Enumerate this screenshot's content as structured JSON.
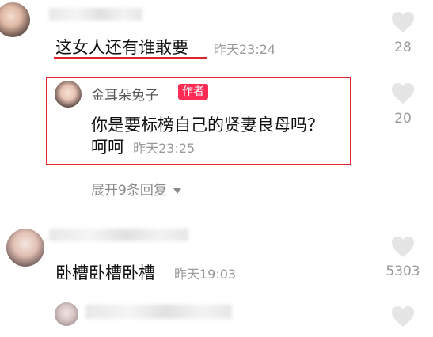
{
  "comments": [
    {
      "text": "这女人还有谁敢要",
      "time": "昨天23:24",
      "likes": "28",
      "reply": {
        "author": "金耳朵兔子",
        "badge": "作者",
        "text_line1": "你是要标榜自己的贤妻良母吗？",
        "text_line2": "呵呵",
        "time": "昨天23:25",
        "likes": "20"
      },
      "expand_label": "展开9条回复"
    },
    {
      "text": "卧槽卧槽卧槽",
      "time": "昨天19:03",
      "likes": "5303"
    }
  ],
  "colors": {
    "highlight_box": "#e0242e",
    "underline": "#e0242e",
    "badge": "#fe2c55",
    "heart": "#e5e5e5"
  },
  "icons": [
    "heart-icon",
    "chevron-down-icon"
  ]
}
